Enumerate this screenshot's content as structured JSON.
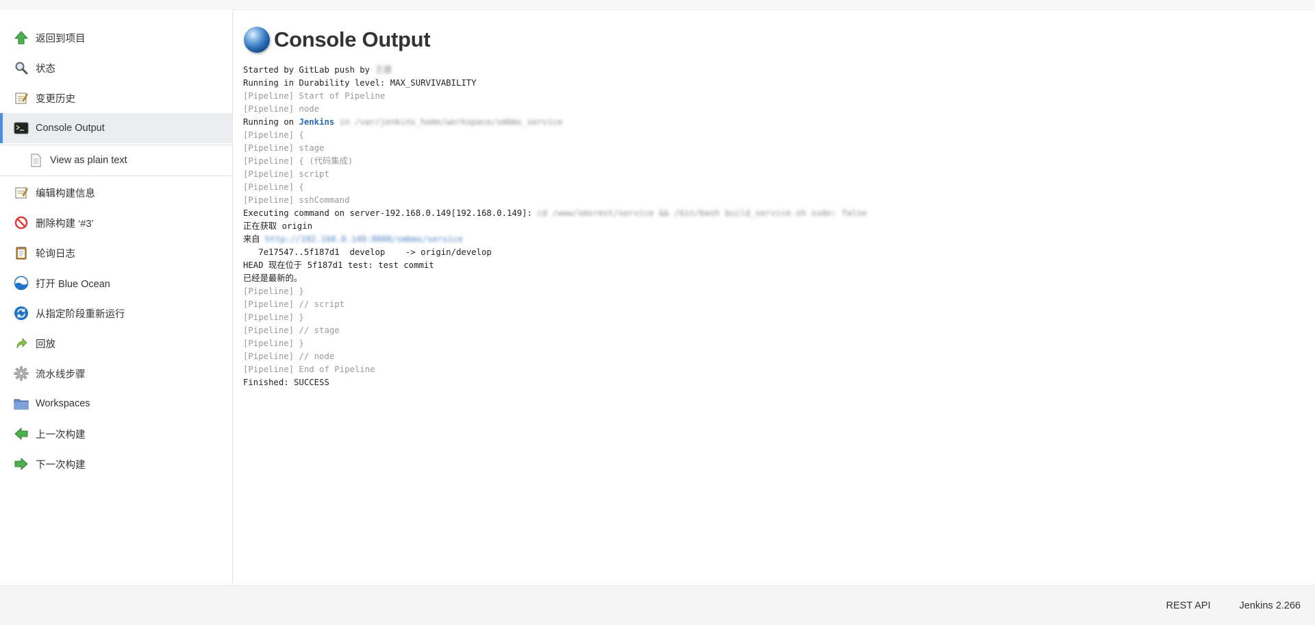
{
  "sidebar": {
    "items": [
      {
        "label": "返回到项目",
        "icon": "back-to-project-up-arrow-icon"
      },
      {
        "label": "状态",
        "icon": "status-magnifier-icon"
      },
      {
        "label": "变更历史",
        "icon": "changes-notepad-icon"
      },
      {
        "label": "Console Output",
        "icon": "terminal-icon",
        "active": true
      },
      {
        "label": "View as plain text",
        "icon": "plain-text-document-icon",
        "sub": true
      },
      {
        "label": "编辑构建信息",
        "icon": "edit-notepad-icon"
      },
      {
        "label": "删除构建 ‘#3’",
        "icon": "delete-no-entry-icon"
      },
      {
        "label": "轮询日志",
        "icon": "clipboard-icon"
      },
      {
        "label": "打开 Blue Ocean",
        "icon": "blue-ocean-icon"
      },
      {
        "label": "从指定阶段重新运行",
        "icon": "rerun-refresh-icon"
      },
      {
        "label": "回放",
        "icon": "replay-arrow-icon"
      },
      {
        "label": "流水线步骤",
        "icon": "gear-icon"
      },
      {
        "label": "Workspaces",
        "icon": "folder-icon"
      },
      {
        "label": "上一次构建",
        "icon": "previous-build-left-arrow-icon"
      },
      {
        "label": "下一次构建",
        "icon": "next-build-right-arrow-icon"
      }
    ]
  },
  "main": {
    "title": "Console Output",
    "title_icon": "console-globe-icon"
  },
  "console": {
    "line1_a": "Started by GitLab push by ",
    "line1_blur": "王建",
    "line2": "Running in Durability level: MAX_SURVIVABILITY",
    "line3": "[Pipeline] Start of Pipeline",
    "line4": "[Pipeline] node",
    "line5_a": "Running on ",
    "line5_link": "Jenkins",
    "line5_blur": " in /var/jenkins_home/workspace/smbms_service",
    "line6": "[Pipeline] {",
    "line7": "[Pipeline] stage",
    "line8": "[Pipeline] { (代码集成)",
    "line9": "[Pipeline] script",
    "line10": "[Pipeline] {",
    "line11": "[Pipeline] sshCommand",
    "line12_a": "Executing command on server-192.168.0.149[192.168.0.149]: ",
    "line12_blur": "cd /www/smsrest/service && /bin/bash build_service.sh sudo: false",
    "line13": "正在获取 origin",
    "line14_a": "来自 ",
    "line14_blur": "http://192.168.0.149:8888/smbms/service",
    "line15": "   7e17547..5f187d1  develop    -> origin/develop",
    "line16": "HEAD 现在位于 5f187d1 test: test commit",
    "line17": "已经是最新的。",
    "line18": "[Pipeline] }",
    "line19": "[Pipeline] // script",
    "line20": "[Pipeline] }",
    "line21": "[Pipeline] // stage",
    "line22": "[Pipeline] }",
    "line23": "[Pipeline] // node",
    "line24": "[Pipeline] End of Pipeline",
    "line25": "Finished: SUCCESS"
  },
  "footer": {
    "rest_api": "REST API",
    "version": "Jenkins 2.266"
  },
  "colors": {
    "accent": "#4a90e2",
    "pipeline_text": "#999999",
    "link": "#2b6cb0"
  }
}
